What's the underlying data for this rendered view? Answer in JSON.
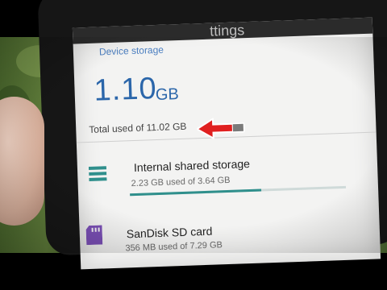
{
  "appbar": {
    "title_fragment": "ttings"
  },
  "section": {
    "header": "Device storage"
  },
  "summary": {
    "used_value": "1.10",
    "used_unit": "GB",
    "total_text": "Total used of 11.02 GB"
  },
  "items": [
    {
      "title": "Internal shared storage",
      "subtitle": "2.23 GB used of 3.64 GB",
      "fraction_used": 0.61,
      "icon": "storage-icon"
    },
    {
      "title": "SanDisk SD card",
      "subtitle": "356 MB used of 7.29 GB",
      "icon": "sd-card-icon"
    }
  ],
  "colors": {
    "accent": "#2b66aa",
    "header": "#4c7fc0",
    "bar": "#2f8f8c",
    "arrow": "#e02020",
    "sd_icon": "#7a4fb5"
  },
  "annotation": {
    "icon": "red-arrow-icon"
  }
}
